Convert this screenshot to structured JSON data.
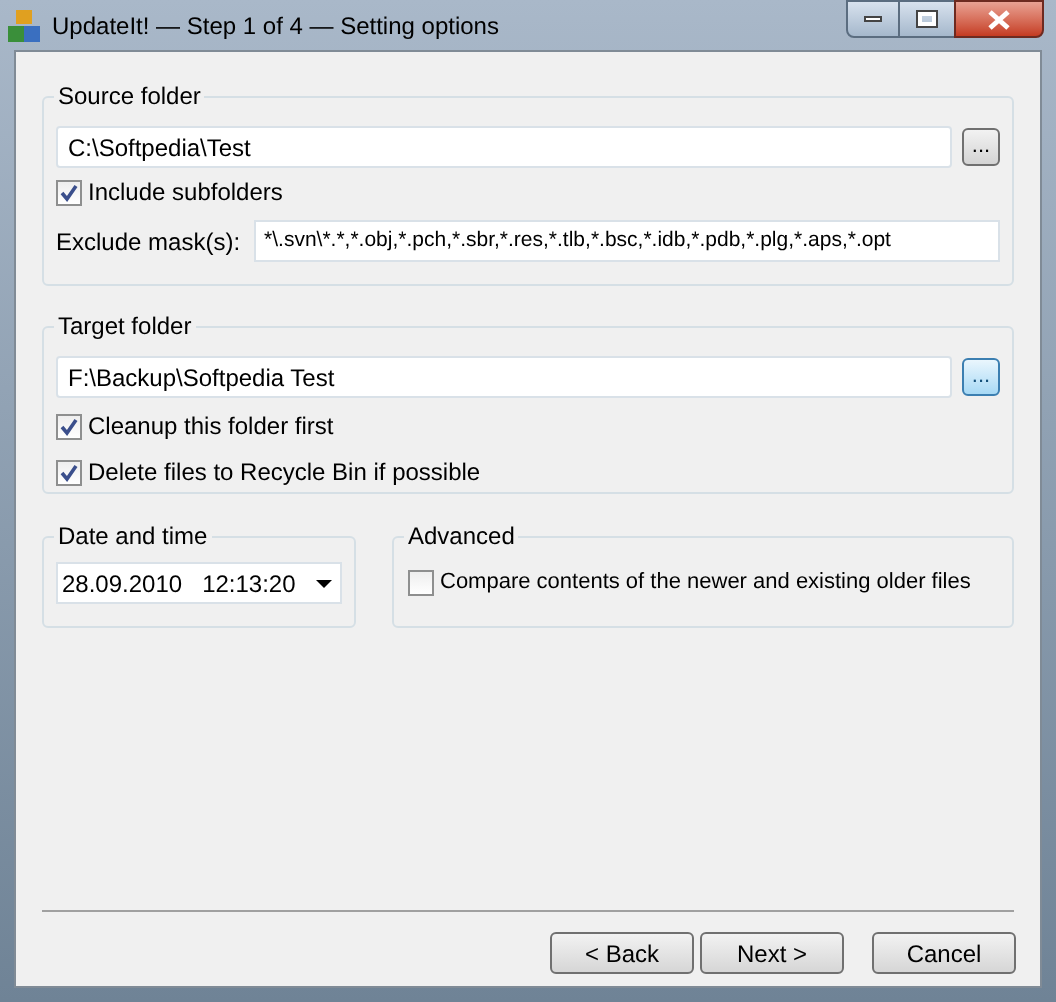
{
  "window": {
    "title": "UpdateIt! — Step 1 of 4 — Setting options"
  },
  "source": {
    "title": "Source folder",
    "path": "C:\\Softpedia\\Test",
    "browse": {
      "label": "...",
      "highlighted": false
    },
    "include_subfolders": {
      "label": "Include subfolders",
      "checked": true
    },
    "exclude_label": "Exclude mask(s):",
    "exclude_mask": "*\\.svn\\*.*,*.obj,*.pch,*.sbr,*.res,*.tlb,*.bsc,*.idb,*.pdb,*.plg,*.aps,*.opt"
  },
  "target": {
    "title": "Target folder",
    "path": "F:\\Backup\\Softpedia Test",
    "browse": {
      "label": "...",
      "highlighted": true
    },
    "options": [
      {
        "label": "Cleanup this folder first",
        "checked": true
      },
      {
        "label": "Delete files to Recycle Bin if possible",
        "checked": true
      }
    ]
  },
  "date_time": {
    "title": "Date and time",
    "date": "28.09.2010",
    "time": "12:13:20"
  },
  "advanced": {
    "title": "Advanced",
    "compare": {
      "label": "Compare contents of the newer and existing older files",
      "checked": false
    }
  },
  "buttons": [
    "< Back",
    "Next >",
    "Cancel"
  ]
}
